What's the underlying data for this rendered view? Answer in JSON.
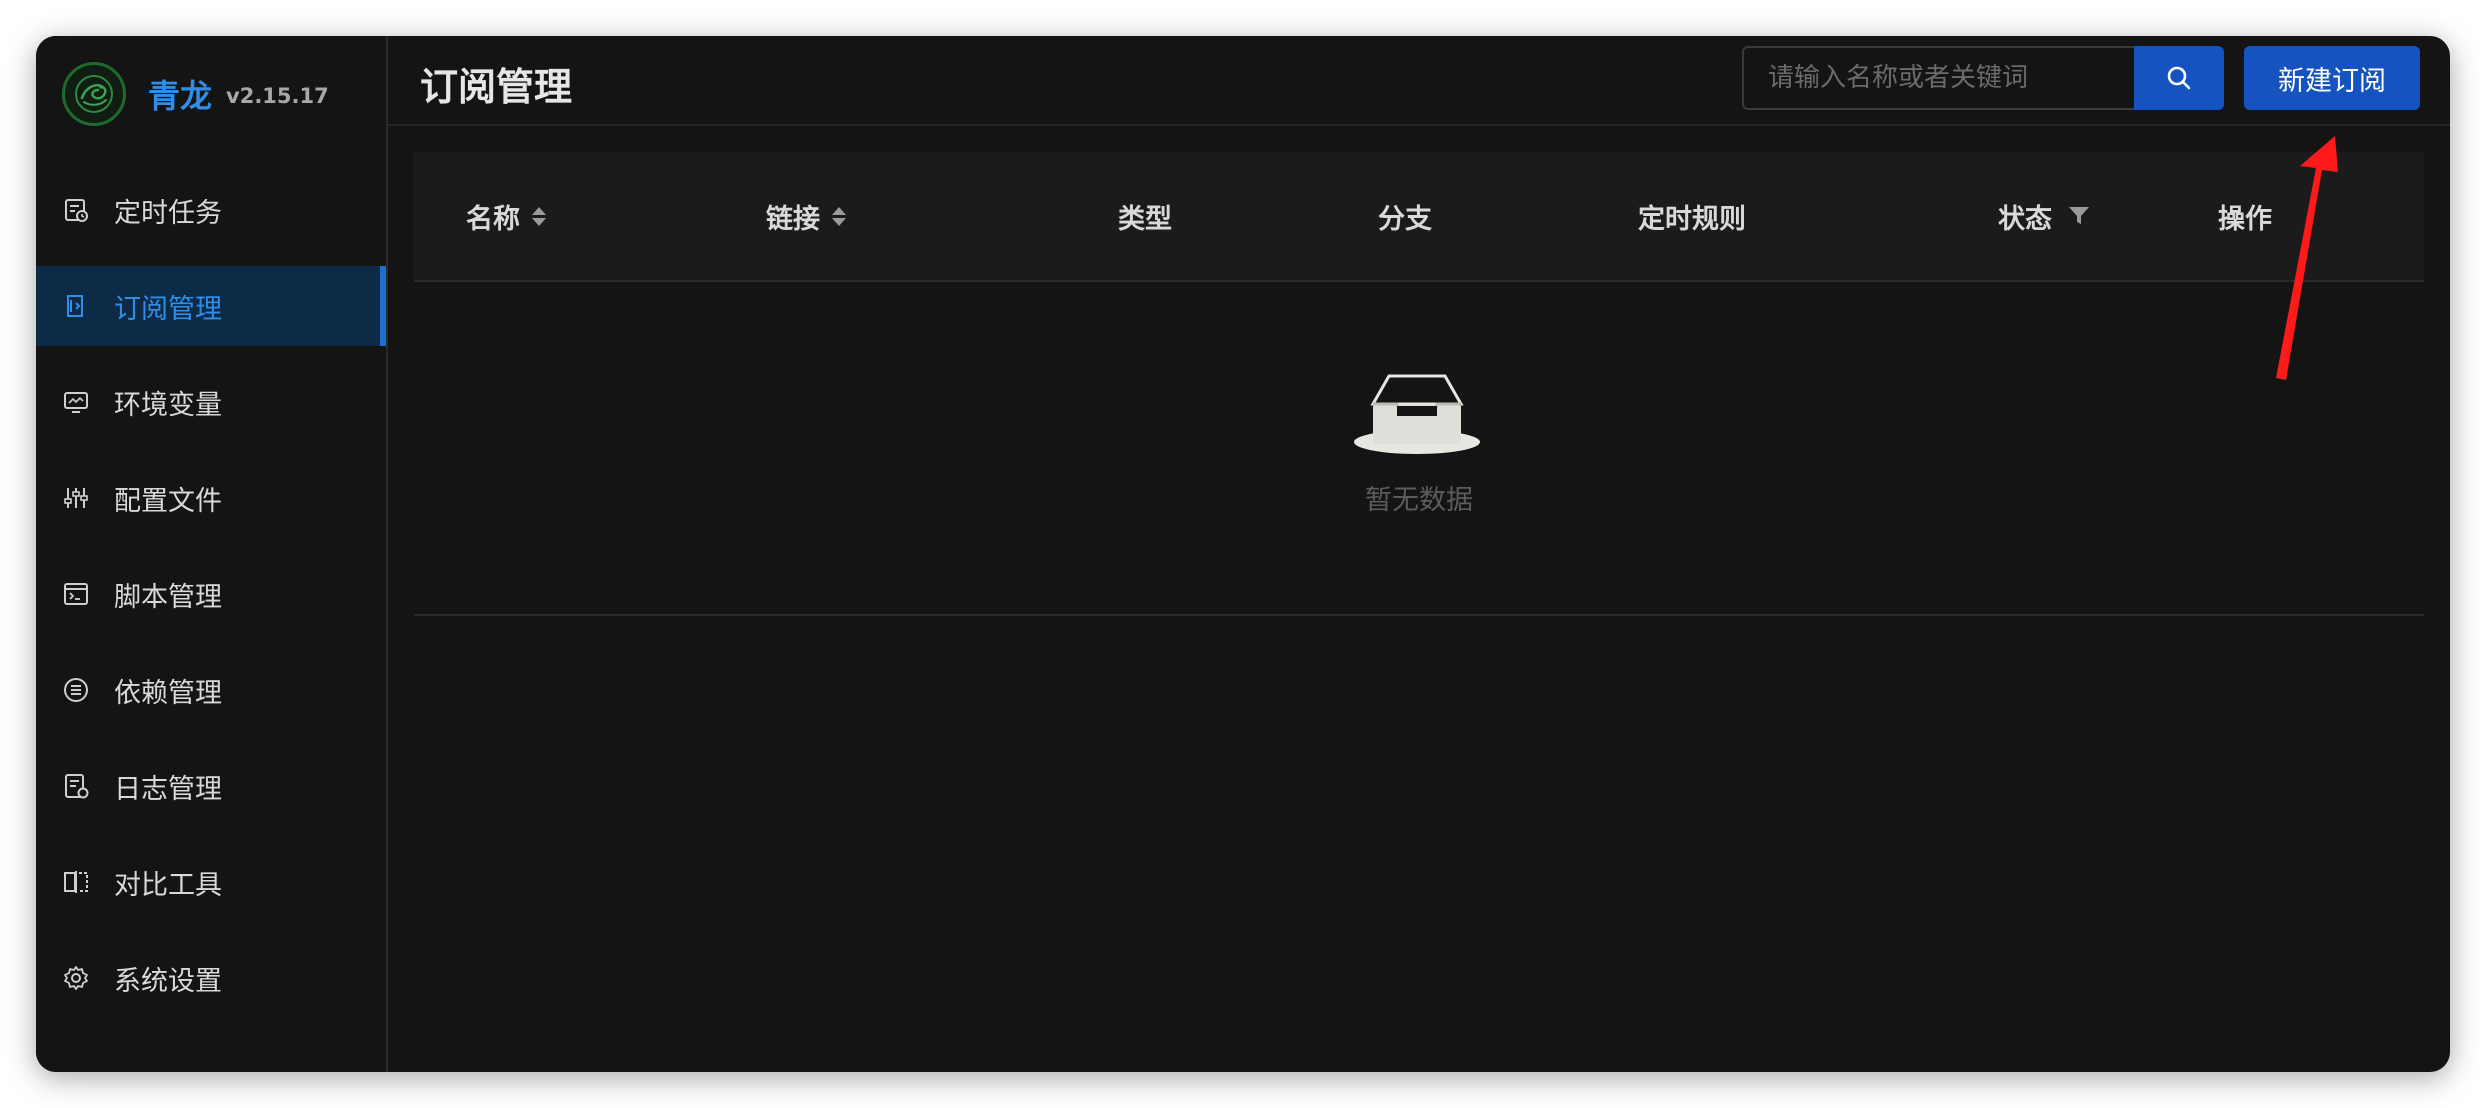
{
  "app": {
    "name": "青龙",
    "version": "v2.15.17"
  },
  "sidebar": {
    "items": [
      {
        "label": "定时任务",
        "icon": "cron-task-icon",
        "active": false
      },
      {
        "label": "订阅管理",
        "icon": "subscription-icon",
        "active": true
      },
      {
        "label": "环境变量",
        "icon": "monitor-icon",
        "active": false
      },
      {
        "label": "配置文件",
        "icon": "sliders-icon",
        "active": false
      },
      {
        "label": "脚本管理",
        "icon": "terminal-icon",
        "active": false
      },
      {
        "label": "依赖管理",
        "icon": "list-circle-icon",
        "active": false
      },
      {
        "label": "日志管理",
        "icon": "log-file-icon",
        "active": false
      },
      {
        "label": "对比工具",
        "icon": "diff-icon",
        "active": false
      },
      {
        "label": "系统设置",
        "icon": "gear-icon",
        "active": false
      }
    ]
  },
  "header": {
    "title": "订阅管理",
    "search_placeholder": "请输入名称或者关键词",
    "new_button_label": "新建订阅"
  },
  "table": {
    "columns": [
      {
        "label": "名称",
        "sortable": true
      },
      {
        "label": "链接",
        "sortable": true
      },
      {
        "label": "类型"
      },
      {
        "label": "分支"
      },
      {
        "label": "定时规则"
      },
      {
        "label": "状态",
        "filterable": true
      },
      {
        "label": "操作"
      }
    ],
    "rows": [],
    "empty_text": "暂无数据"
  },
  "colors": {
    "accent": "#1554c0",
    "brand_text": "#2f8fe8",
    "background": "#141414",
    "annotation_arrow": "#ff1a1a"
  }
}
